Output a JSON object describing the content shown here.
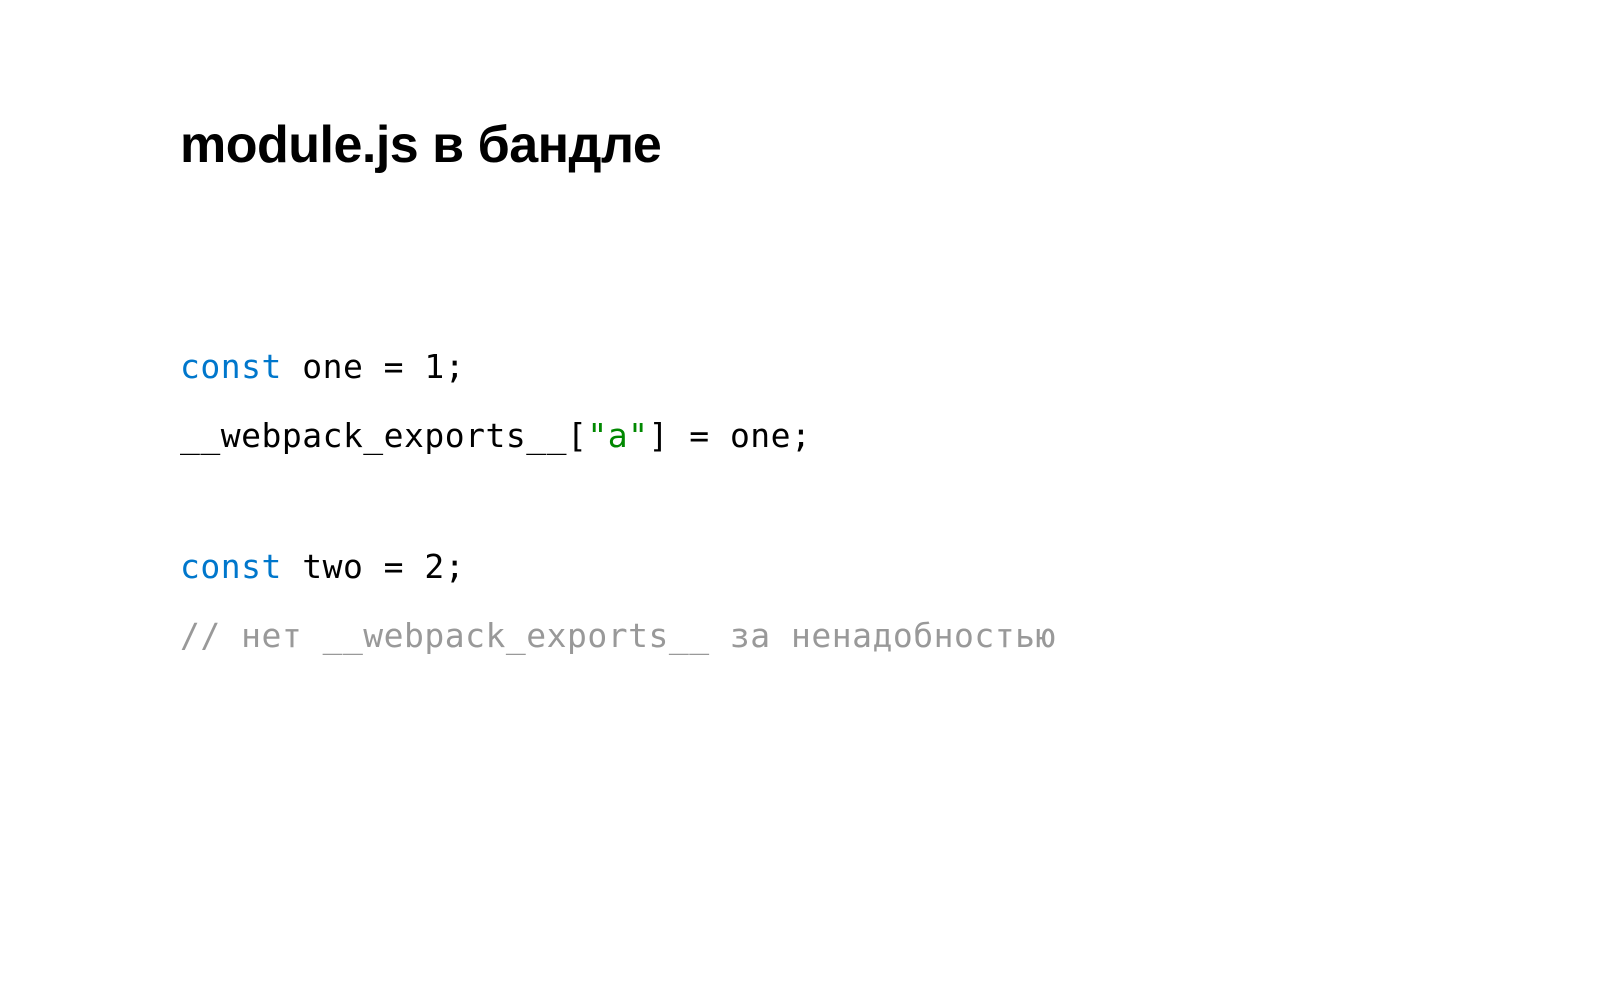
{
  "title": "module.js в бандле",
  "code": {
    "line1": {
      "keyword": "const",
      "rest": " one = 1;"
    },
    "line2": {
      "part1": "__webpack_exports__[",
      "string": "\"a\"",
      "part2": "] = one;"
    },
    "line3": {
      "keyword": "const",
      "rest": " two = 2;"
    },
    "line4": {
      "comment": "// нет __webpack_exports__ за ненадобностью"
    }
  }
}
